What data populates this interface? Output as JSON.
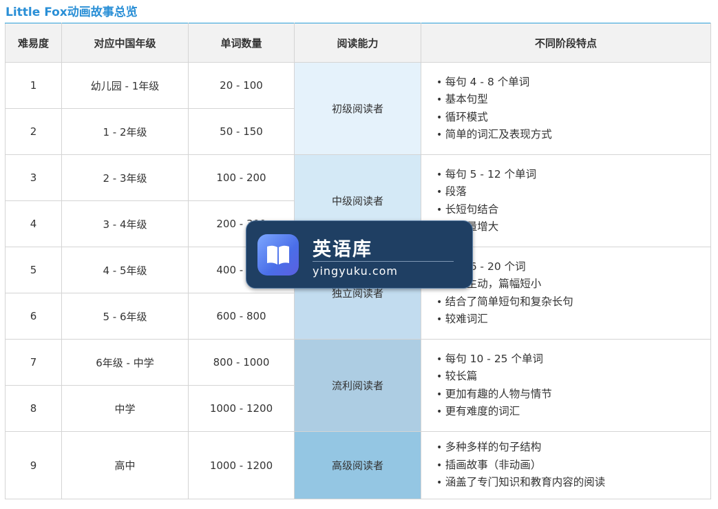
{
  "page_title": "Little Fox动画故事总览",
  "headers": [
    "难易度",
    "对应中国年级",
    "单词数量",
    "阅读能力",
    "不同阶段特点"
  ],
  "rows": [
    {
      "level": "1",
      "grade": "幼儿园 - 1年级",
      "words": "20 - 100"
    },
    {
      "level": "2",
      "grade": "1 - 2年级",
      "words": "50 - 150"
    },
    {
      "level": "3",
      "grade": "2 - 3年级",
      "words": "100 - 200"
    },
    {
      "level": "4",
      "grade": "3 - 4年级",
      "words": "200 - 300"
    },
    {
      "level": "5",
      "grade": "4 - 5年级",
      "words": "400 - 600"
    },
    {
      "level": "6",
      "grade": "5 - 6年级",
      "words": "600 - 800"
    },
    {
      "level": "7",
      "grade": "6年级 - 中学",
      "words": "800 - 1000"
    },
    {
      "level": "8",
      "grade": "中学",
      "words": "1000 - 1200"
    },
    {
      "level": "9",
      "grade": "高中",
      "words": "1000 - 1200"
    }
  ],
  "stages": [
    {
      "reader": "初级阅读者",
      "color": "#e5f2fb",
      "features": [
        "每句 4 - 8 个单词",
        "基本句型",
        "循环模式",
        "简单的词汇及表现方式"
      ]
    },
    {
      "reader": "中级阅读者",
      "color": "#d4e9f6",
      "features": [
        "每句 5 - 12 个单词",
        "段落",
        "长短句结合",
        "词汇量增大"
      ]
    },
    {
      "reader": "独立阅读者",
      "color": "#c2dcef",
      "features": [
        "每句 6 - 20 个词",
        "阅读主动，篇幅短小",
        "结合了简单短句和复杂长句",
        "较难词汇"
      ]
    },
    {
      "reader": "流利阅读者",
      "color": "#adcde3",
      "features": [
        "每句 10 - 25 个单词",
        "较长篇",
        "更加有趣的人物与情节",
        "更有难度的词汇"
      ]
    },
    {
      "reader": "高级阅读者",
      "color": "#94c6e3",
      "features": [
        "多种多样的句子结构",
        "插画故事（非动画）",
        "涵盖了专门知识和教育内容的阅读"
      ]
    }
  ],
  "watermark": {
    "name": "英语库",
    "url": "yingyuku.com",
    "icon": "book-icon"
  }
}
